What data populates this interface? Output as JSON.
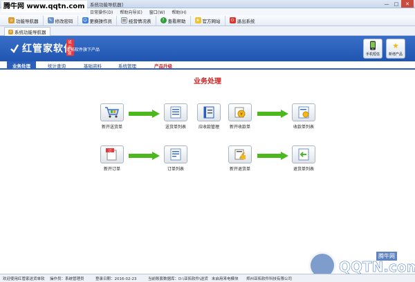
{
  "window": {
    "title": "系统功能导航器]",
    "watermark_top": "腾牛网 www.qqtn.com",
    "buttons": {
      "minimize": "—",
      "restore": "□",
      "close": "✕"
    }
  },
  "menu": {
    "items": [
      "日常操作(D)",
      "帮助向导(E)",
      "窗口(W)",
      "帮助(H)"
    ]
  },
  "toolbar": {
    "items": [
      {
        "label": "功能导航器",
        "icon": "home-icon"
      },
      {
        "label": "修改密码",
        "icon": "key-icon"
      },
      {
        "label": "更换操作员",
        "icon": "users-icon"
      },
      {
        "label": "经营情况表",
        "icon": "report-icon"
      },
      {
        "label": "查看帮助",
        "icon": "help-icon"
      },
      {
        "label": "官方网站",
        "icon": "star-icon"
      },
      {
        "label": "退出系统",
        "icon": "exit-icon"
      }
    ]
  },
  "nav_tab": {
    "label": "系统功能导航器"
  },
  "brand": {
    "name": "红管家软件",
    "trial": "试用版",
    "subtitle": "亚拓软件旗下产品"
  },
  "header_buttons": {
    "mobile": "手机短信",
    "new_products": "新增产品"
  },
  "function_tabs": [
    "业务处理",
    "统计查询",
    "基础资料",
    "系统管理",
    "产品升级"
  ],
  "main": {
    "title": "业务处理",
    "buttons": {
      "new_delivery": "新开送货单",
      "delivery_list": "送货单列表",
      "receivable": "应收款管理",
      "new_receipt": "新开收款单",
      "receipt_list": "收款单列表",
      "new_order": "新开订单",
      "order_list": "订单列表",
      "new_return": "新开退货单",
      "return_list": "退货单列表"
    }
  },
  "status": {
    "welcome": "欢迎使用红管家送货单软",
    "operator": "操作员：系统管理员",
    "login_date": "登录日期：2016-02-23",
    "database": "当前账套数据库：D:\\亚拓软件\\送货",
    "sms": "未启用来电模块",
    "company": "郑州亚拓软件科技有限公司"
  },
  "watermark_bottom": {
    "brand": "QQTN.com",
    "tag": "腾牛网"
  },
  "colors": {
    "header_blue": "#2c5fba",
    "accent_red": "#d21f1f",
    "arrow_green": "#4cb81e"
  }
}
